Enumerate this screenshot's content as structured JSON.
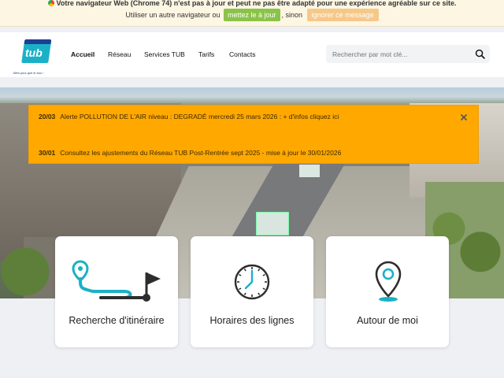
{
  "browser_warning": {
    "message": "Votre navigateur Web (Chrome 74) n'est pas à jour et peut ne pas être adapté pour une expérience agréable sur ce site.",
    "prompt_before": "Utiliser un autre navigateur ou",
    "update_label": "mettez le à jour",
    "prompt_middle": ", sinon",
    "ignore_label": "ignorer ce message"
  },
  "header": {
    "logo_text": "tub",
    "logo_tagline": "Bien plus que le bus !",
    "nav": [
      "Accueil",
      "Réseau",
      "Services TUB",
      "Tarifs",
      "Contacts"
    ],
    "search_placeholder": "Rechercher par mot clé..."
  },
  "alerts": [
    {
      "date": "20/03",
      "text": "Alerte POLLUTION DE L'AIR niveau : DEGRADÉ mercredi 25 mars 2026 : + d'infos cliquez ici"
    },
    {
      "date": "30/01",
      "text": "Consultez les ajustements du Réseau TUB Post-Rentrée sept 2025 - mise à jour le 30/01/2026"
    }
  ],
  "cards": [
    {
      "label": "Recherche d'itinéraire",
      "icon": "route-flag-icon"
    },
    {
      "label": "Horaires des lignes",
      "icon": "clock-icon"
    },
    {
      "label": "Autour de moi",
      "icon": "map-pin-icon"
    }
  ],
  "colors": {
    "accent": "#1ab1c7",
    "alert_bg": "#ffa800",
    "update_button": "#8bc34a",
    "ignore_button": "#f5c88a"
  }
}
